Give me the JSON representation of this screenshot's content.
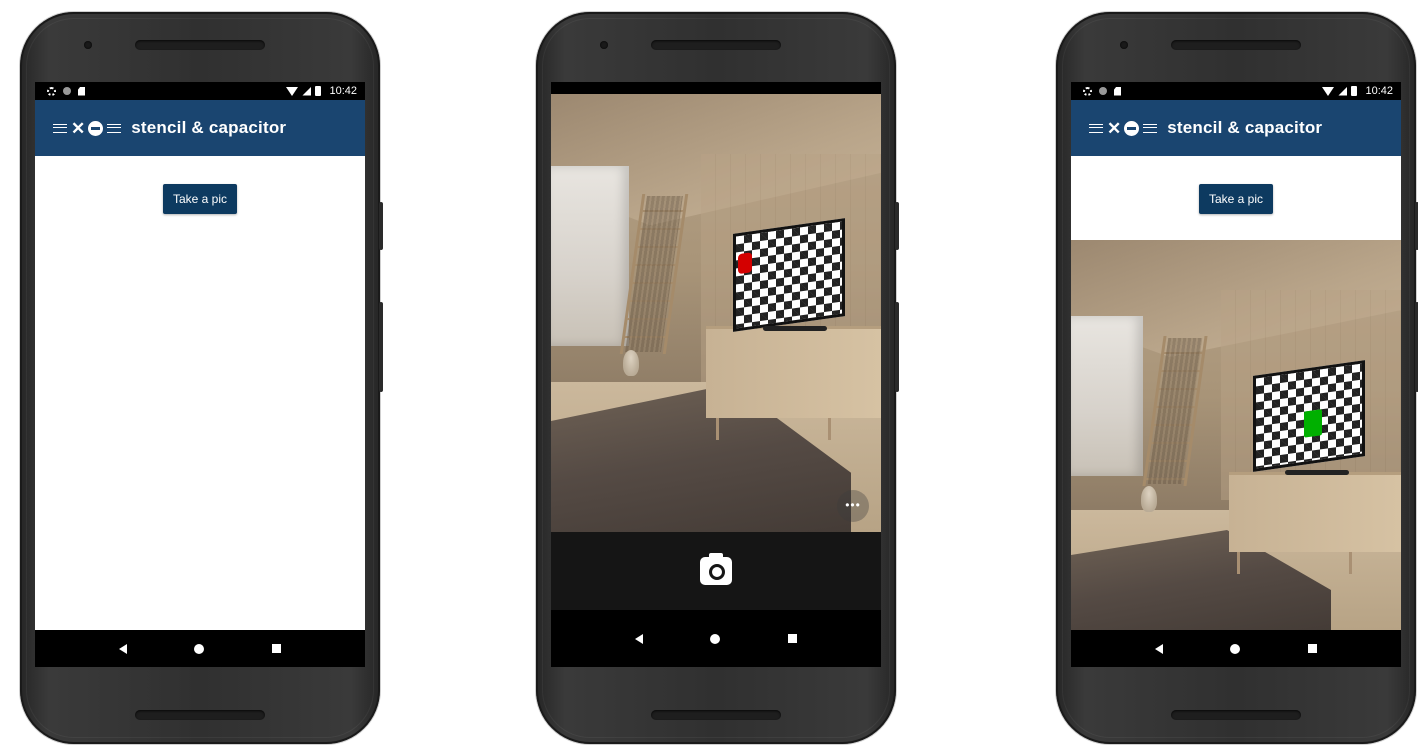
{
  "status_bar": {
    "time": "10:42"
  },
  "app": {
    "title": "stencil & capacitor"
  },
  "home": {
    "take_pic_label": "Take a pic"
  },
  "camera": {
    "more_label": "•••"
  },
  "colors": {
    "toolbar": "#1a4570",
    "button": "#0d3a60",
    "marker_before": "#d40000",
    "marker_after": "#00b000"
  },
  "icons": {
    "status_left": [
      "settings-icon",
      "circle-icon",
      "sd-card-icon"
    ],
    "status_right": [
      "wifi-icon",
      "signal-icon",
      "battery-icon"
    ],
    "nav": [
      "back-icon",
      "home-icon",
      "recents-icon"
    ],
    "camera": "camera-shutter-icon"
  }
}
